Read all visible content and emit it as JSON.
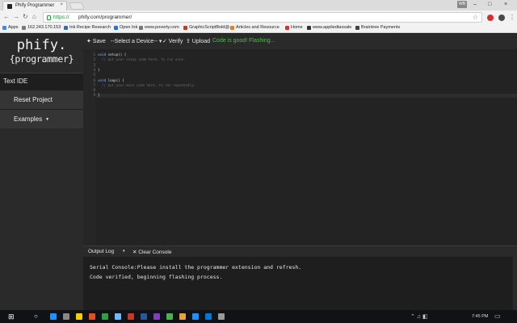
{
  "browser": {
    "tab_title": "Phify Programmer",
    "tab_close": "×",
    "user_badge": "WB",
    "window_controls": [
      "–",
      "□",
      "×"
    ],
    "nav": {
      "back": "←",
      "forward": "→",
      "reload": "↻",
      "home": "⌂"
    },
    "url_scheme": "https://",
    "url_rest": "phify.com/programmer/",
    "star": "☆",
    "menu": "⋮",
    "bookmarks": [
      {
        "label": "Apps",
        "color": "#4285f4"
      },
      {
        "label": "162.243.170.153",
        "color": "#7a7a7a"
      },
      {
        "label": "Ink Recipe Research",
        "color": "#2f6eb5"
      },
      {
        "label": "Open Ink",
        "color": "#1a73e8"
      },
      {
        "label": "www.poverty.com",
        "color": "#777777"
      },
      {
        "label": "GraphicScriptBold@...",
        "color": "#c0392b"
      },
      {
        "label": "Articles and Resource",
        "color": "#e67e22"
      },
      {
        "label": "Home",
        "color": "#d93025"
      },
      {
        "label": "www.appliedtaxsale",
        "color": "#333333"
      },
      {
        "label": "Braintree Payments",
        "color": "#444444"
      }
    ]
  },
  "sidebar": {
    "logo_line1": "phify.",
    "logo_line2": "{programmer}",
    "section": "Text IDE",
    "items": [
      {
        "label": "Reset Project"
      },
      {
        "label": "Examples",
        "caret": "▼"
      }
    ]
  },
  "toolbar": {
    "save": "✦ Save",
    "device": "--Select a Device--",
    "device_caret": "▾",
    "verify": "✓ Verify",
    "upload": "⇪ Upload",
    "status": "Code is good! Flashing..."
  },
  "editor": {
    "line_numbers": [
      "1",
      "2",
      "3",
      "4",
      "5",
      "6",
      "7",
      "8",
      "9"
    ],
    "lines": [
      {
        "kw": "void",
        "rest": " setup() {",
        "comment": ""
      },
      {
        "kw": "",
        "rest": "  ",
        "comment": "// put your setup code here, to run once:"
      },
      {
        "kw": "",
        "rest": "",
        "comment": ""
      },
      {
        "kw": "",
        "rest": "}",
        "comment": ""
      },
      {
        "kw": "",
        "rest": "",
        "comment": ""
      },
      {
        "kw": "void",
        "rest": " loop() {",
        "comment": ""
      },
      {
        "kw": "",
        "rest": "  ",
        "comment": "// put your main code here, to run repeatedly:"
      },
      {
        "kw": "",
        "rest": "",
        "comment": ""
      },
      {
        "kw": "",
        "rest": "}",
        "comment": ""
      }
    ]
  },
  "console": {
    "log_select": "Output Log",
    "log_caret": "▾",
    "clear": "✕ Clear Console",
    "lines": [
      "Serial Console:Please install the programmer extension and refresh.",
      "Code verified, beginning flashing process."
    ]
  },
  "taskbar": {
    "clock": "7:45 PM",
    "icon_colors": [
      "#1e90ff",
      "#888888",
      "#ffcc00",
      "#e44d26",
      "#2ea043",
      "#6fb7ff",
      "#c0392b",
      "#2b579a",
      "#7f3fbf",
      "#4caf50",
      "#e8a33d",
      "#1e90ff",
      "#0078d7",
      "#999999"
    ]
  }
}
